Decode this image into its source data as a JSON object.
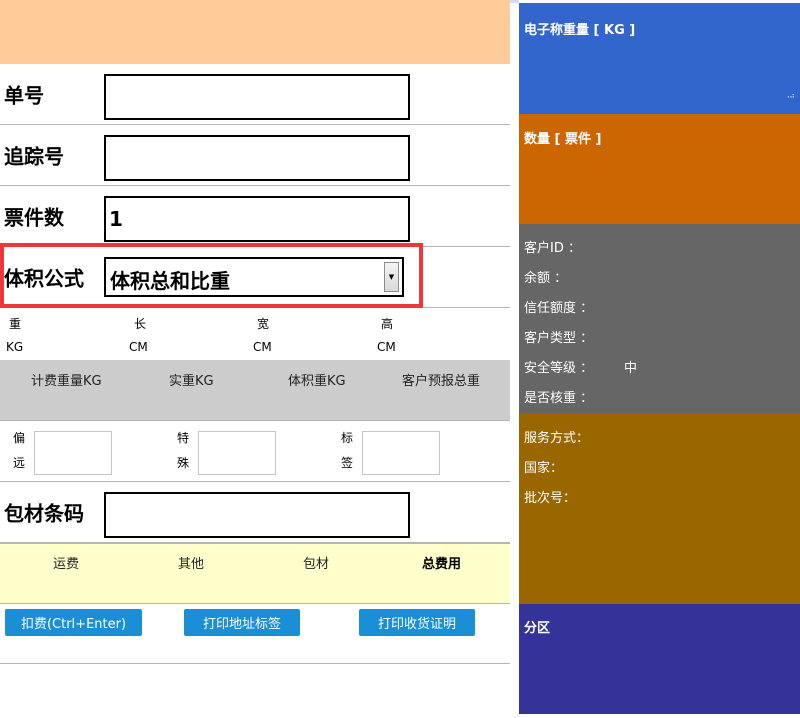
{
  "form": {
    "order_no_label": "单号",
    "order_no_value": "",
    "tracking_label": "追踪号",
    "tracking_value": "",
    "pieces_label": "票件数",
    "pieces_value": "1",
    "volume_formula_label": "体积公式",
    "volume_formula_selected": "体积总和比重"
  },
  "dims": {
    "weight": "重",
    "weight_unit": "KG",
    "length": "长",
    "length_unit": "CM",
    "width": "宽",
    "width_unit": "CM",
    "height": "高",
    "height_unit": "CM"
  },
  "weights": {
    "billing": "计费重量KG",
    "actual": "实重KG",
    "volumetric": "体积重KG",
    "declared_total": "客户预报总重"
  },
  "extras": {
    "remote_1": "偏",
    "remote_2": "远",
    "special_1": "特",
    "special_2": "殊",
    "label_1": "标",
    "label_2": "签"
  },
  "packaging": {
    "label": "包材条码",
    "value": ""
  },
  "fees": {
    "freight": "运费",
    "other": "其他",
    "packaging": "包材",
    "total": "总费用"
  },
  "buttons": {
    "charge": "扣费(Ctrl+Enter)",
    "print_address": "打印地址标签",
    "print_receipt": "打印收货证明"
  },
  "side": {
    "scale_title": "电子称重量 [ KG ]",
    "quantity_title": "数量 [ 票件 ]",
    "customer_id": "客户ID ：",
    "balance": "余额 ：",
    "credit": "信任额度 ：",
    "customer_type": "客户类型 ：",
    "security_level": "安全等级 ：",
    "security_level_value": "中",
    "verify_weight": "是否核重 ：",
    "service": "服务方式：",
    "country": "国家：",
    "batch": "批次号：",
    "zone_title": "分区"
  },
  "colors": {
    "scale_panel": "#3366cc",
    "quantity_panel": "#cc6600",
    "customer_panel": "#666666",
    "service_panel": "#996600",
    "zone_panel": "#333399",
    "button": "#1a8fd6",
    "highlight": "#f0363b"
  }
}
